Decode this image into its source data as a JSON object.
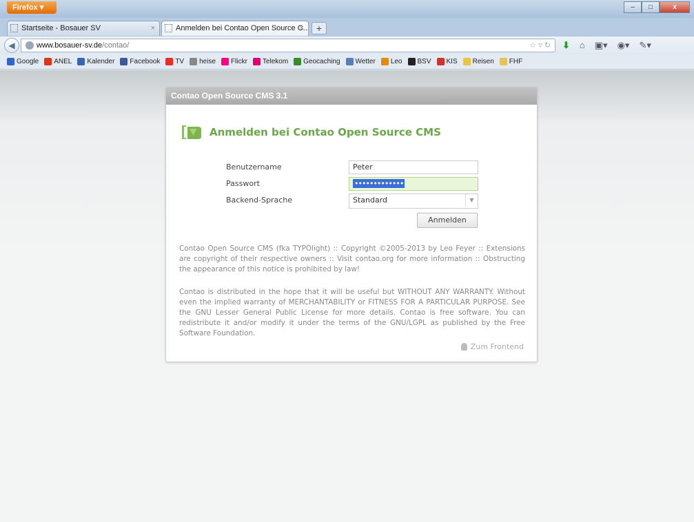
{
  "browser": {
    "menu_label": "Firefox ▾",
    "tabs": [
      {
        "label": "Startseite - Bosauer SV",
        "close": "×"
      },
      {
        "label": "Anmelden bei Contao Open Source C...",
        "close": "×"
      }
    ],
    "new_tab": "+",
    "url": {
      "domain": "www.bosauer-sv.de",
      "path": "/contao/"
    },
    "window_controls": {
      "minimize": "–",
      "maximize": "□",
      "close": "x"
    }
  },
  "bookmarks": [
    {
      "label": "Google",
      "color": "#3366cc"
    },
    {
      "label": "ANEL",
      "color": "#d9381e"
    },
    {
      "label": "Kalender",
      "color": "#3a66b0"
    },
    {
      "label": "Facebook",
      "color": "#3b5998"
    },
    {
      "label": "TV",
      "color": "#e5302a"
    },
    {
      "label": "heise",
      "color": "#888888"
    },
    {
      "label": "Flickr",
      "color": "#ff0084"
    },
    {
      "label": "Telekom",
      "color": "#e20074"
    },
    {
      "label": "Geocaching",
      "color": "#3a8b2f"
    },
    {
      "label": "Wetter",
      "color": "#5a7fb5"
    },
    {
      "label": "Leo",
      "color": "#e68a00"
    },
    {
      "label": "BSV",
      "color": "#222222"
    },
    {
      "label": "KIS",
      "color": "#cc3333"
    },
    {
      "label": "Reisen",
      "color": "#e8c44a"
    },
    {
      "label": "FHF",
      "color": "#e8c44a"
    }
  ],
  "login": {
    "header": "Contao Open Source CMS 3.1",
    "headline": "Anmelden bei Contao Open Source CMS",
    "username_label": "Benutzername",
    "username_value": "Peter",
    "password_label": "Passwort",
    "password_value": "•••••••••••••",
    "language_label": "Backend-Sprache",
    "language_value": "Standard",
    "submit_label": "Anmelden",
    "copyright": "Contao Open Source CMS (fka TYPOlight) :: Copyright ©2005-2013 by Leo Feyer :: Extensions are copyright of their respective owners :: Visit contao.org for more information :: Obstructing the appearance of this notice is prohibited by law!",
    "license": "Contao is distributed in the hope that it will be useful but WITHOUT ANY WARRANTY. Without even the implied warranty of MERCHANTABILITY or FITNESS FOR A PARTICULAR PURPOSE. See the GNU Lesser General Public License for more details. Contao is free software. You can redistribute it and/or modify it under the terms of the GNU/LGPL as published by the Free Software Foundation.",
    "frontend_link": "Zum Frontend",
    "accent_color": "#6aa84a"
  }
}
